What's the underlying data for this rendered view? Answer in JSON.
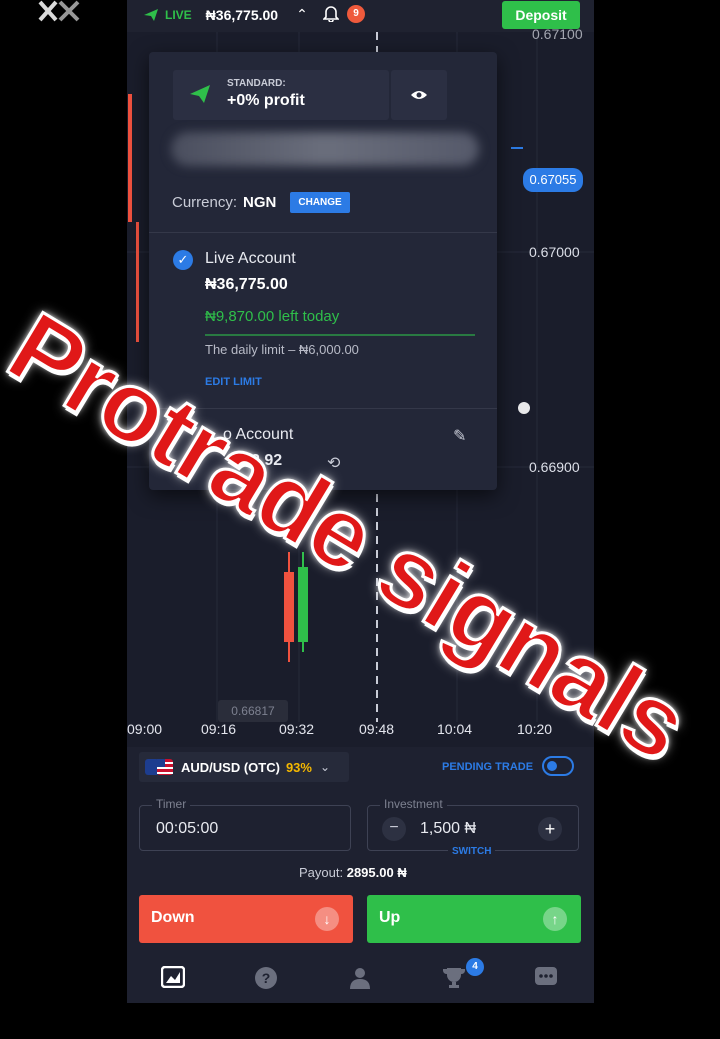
{
  "topbar": {
    "live_label": "LIVE",
    "balance": "₦36,775.00",
    "notification_count": "9",
    "deposit_label": "Deposit"
  },
  "chart": {
    "price_top_partial": "0.67100",
    "current_price": "0.67055",
    "price_levels": [
      "0.67000",
      "0.66900"
    ],
    "low_price_tag": "0.66817",
    "time_labels": [
      "09:00",
      "09:16",
      "09:32",
      "09:48",
      "10:04",
      "10:20"
    ]
  },
  "account_menu": {
    "plan_small": "STANDARD:",
    "plan_big": "+0% profit",
    "currency_label": "Currency:",
    "currency_value": "NGN",
    "change_label": "CHANGE",
    "live_account": {
      "title": "Live Account",
      "balance": "₦36,775.00",
      "left_today": "₦9,870.00 left today",
      "daily_limit": "The daily limit – ₦6,000.00",
      "edit_limit": "EDIT LIMIT"
    },
    "demo_account": {
      "title": "o Account",
      "balance": "2.92"
    }
  },
  "trade_panel": {
    "asset_name": "AUD/USD (OTC)",
    "asset_payout_pct": "93%",
    "pending_trade_label": "PENDING TRADE",
    "timer_label": "Timer",
    "timer_value": "00:05:00",
    "investment_label": "Investment",
    "investment_value": "1,500 ₦",
    "switch_label": "SWITCH",
    "payout_label": "Payout:",
    "payout_value": "2895.00 ₦",
    "down_label": "Down",
    "up_label": "Up"
  },
  "bottom_nav": {
    "icons": [
      "chart-icon",
      "help-icon",
      "user-icon",
      "trophy-icon",
      "chat-icon"
    ],
    "trophy_badge": "4"
  },
  "overlay": {
    "watermark_text": "Protrade signals"
  },
  "colors": {
    "green": "#2fbf4a",
    "red": "#f0523f",
    "blue": "#2c7be5",
    "gold": "#f5b800",
    "watermark_red": "#e01818"
  }
}
